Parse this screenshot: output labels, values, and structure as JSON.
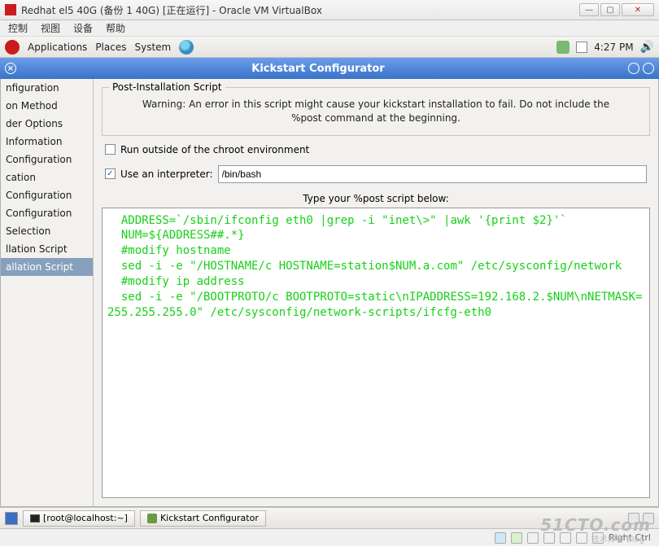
{
  "vbox": {
    "title": "Redhat el5 40G (备份 1 40G) [正在运行] - Oracle VM VirtualBox",
    "menus": [
      "控制",
      "视图",
      "设备",
      "帮助"
    ]
  },
  "gnome": {
    "apps": "Applications",
    "places": "Places",
    "system": "System",
    "time": "4:27 PM"
  },
  "app": {
    "title": "Kickstart Configurator"
  },
  "sidebar": {
    "items": [
      {
        "label": "nfiguration"
      },
      {
        "label": "on Method"
      },
      {
        "label": "der Options"
      },
      {
        "label": "Information"
      },
      {
        "label": "Configuration"
      },
      {
        "label": "cation"
      },
      {
        "label": "Configuration"
      },
      {
        "label": "Configuration"
      },
      {
        "label": "Selection"
      },
      {
        "label": "llation Script"
      },
      {
        "label": "allation Script"
      }
    ],
    "selected_index": 10
  },
  "post": {
    "group_title": "Post-Installation Script",
    "warning": "Warning: An error in this script might cause your kickstart installation to fail. Do not include the %post command at the beginning.",
    "chroot_label": "Run outside of the chroot environment",
    "chroot_checked": false,
    "interp_label": "Use an interpreter:",
    "interp_checked": true,
    "interp_value": "/bin/bash",
    "script_label": "Type your %post script below:",
    "script": "  ADDRESS=`/sbin/ifconfig eth0 |grep -i \"inet\\>\" |awk '{print $2}'`\n  NUM=${ADDRESS##.*}\n  #modify hostname\n  sed -i -e \"/HOSTNAME/c HOSTNAME=station$NUM.a.com\" /etc/sysconfig/network\n  #modify ip address\n  sed -i -e \"/BOOTPROTO/c BOOTPROTO=static\\nIPADDRESS=192.168.2.$NUM\\nNETMASK=255.255.255.0\" /etc/sysconfig/network-scripts/ifcfg-eth0"
  },
  "taskbar": {
    "term": "[root@localhost:~]",
    "ks": "Kickstart Configurator"
  },
  "status": {
    "text": "Right Ctrl"
  },
  "watermark": {
    "main": "51CTO.com",
    "sub": "技术博客  Blog"
  }
}
